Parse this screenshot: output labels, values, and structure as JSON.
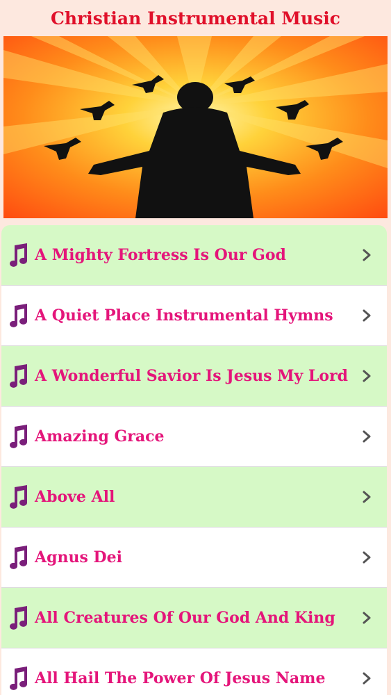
{
  "header": {
    "title": "Christian Instrumental Music"
  },
  "banner": {
    "icon": "worship-silhouette-doves-image"
  },
  "list": {
    "items": [
      {
        "label": "A Mighty Fortress Is Our God",
        "bg": "green"
      },
      {
        "label": "A Quiet Place Instrumental Hymns",
        "bg": "white"
      },
      {
        "label": "A Wonderful Savior Is Jesus My Lord",
        "bg": "green"
      },
      {
        "label": "Amazing Grace",
        "bg": "white"
      },
      {
        "label": "Above All",
        "bg": "green"
      },
      {
        "label": "Agnus Dei",
        "bg": "white"
      },
      {
        "label": "All Creatures Of Our God And King",
        "bg": "green"
      },
      {
        "label": "All Hail The Power Of Jesus Name",
        "bg": "white"
      }
    ]
  },
  "colors": {
    "title": "#e0102a",
    "label": "#e4157a",
    "note": "#7a1f7a",
    "green_row": "#d6f9c6",
    "white_row": "#ffffff",
    "background": "#fde8df",
    "chevron": "#555555"
  }
}
